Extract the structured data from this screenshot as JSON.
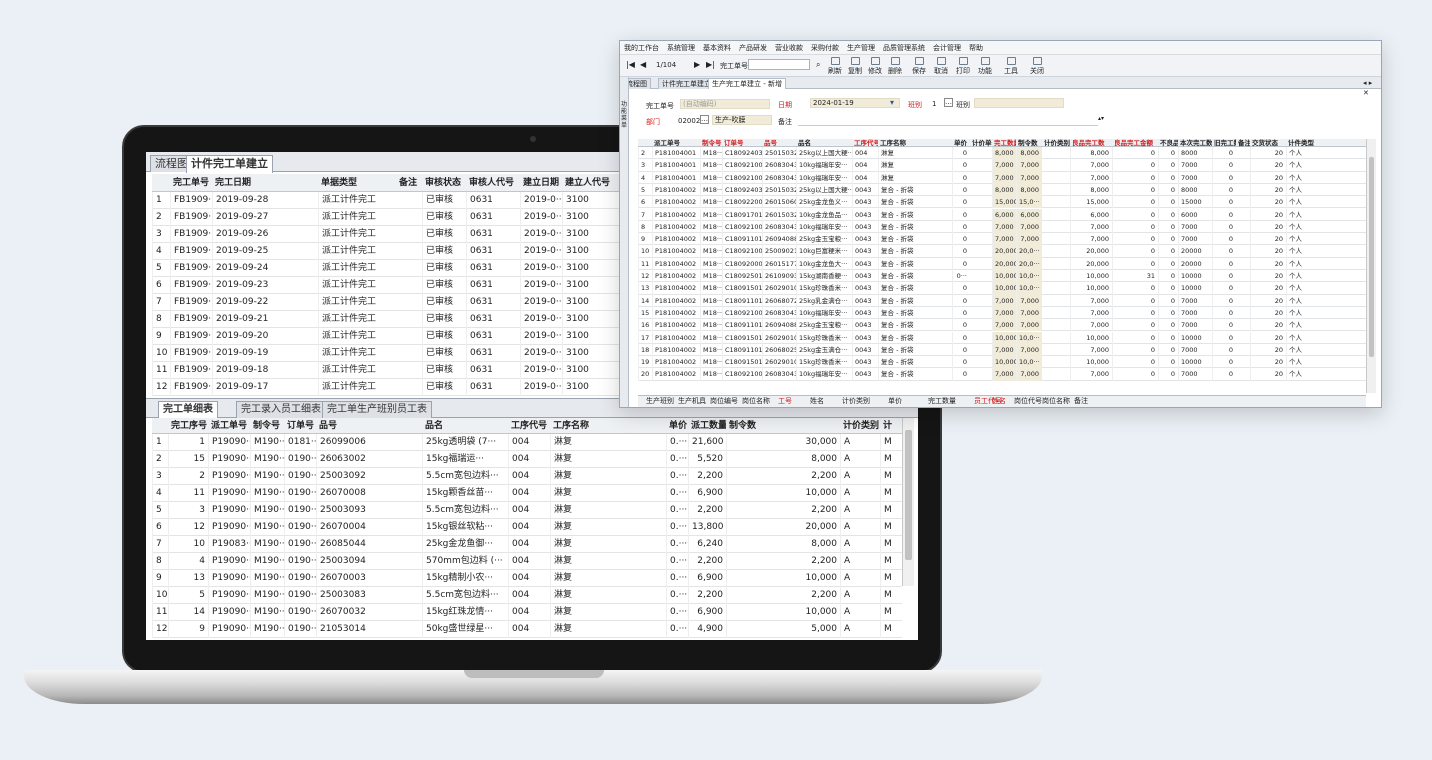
{
  "laptop": {
    "tabs": [
      "流程图",
      "计件完工单建立"
    ],
    "top_grid": {
      "headers": [
        "完工单号",
        "完工日期",
        "单据类型",
        "备注",
        "审核状态",
        "审核人代号",
        "建立日期",
        "建立人代号"
      ],
      "rows": [
        [
          "1",
          "FB1909···",
          "2019-09-28",
          "派工计件完工",
          "",
          "已审核",
          "0631",
          "2019-0···",
          "3100"
        ],
        [
          "2",
          "FB1909···",
          "2019-09-27",
          "派工计件完工",
          "",
          "已审核",
          "0631",
          "2019-0···",
          "3100"
        ],
        [
          "3",
          "FB1909···",
          "2019-09-26",
          "派工计件完工",
          "",
          "已审核",
          "0631",
          "2019-0···",
          "3100"
        ],
        [
          "4",
          "FB1909···",
          "2019-09-25",
          "派工计件完工",
          "",
          "已审核",
          "0631",
          "2019-0···",
          "3100"
        ],
        [
          "5",
          "FB1909···",
          "2019-09-24",
          "派工计件完工",
          "",
          "已审核",
          "0631",
          "2019-0···",
          "3100"
        ],
        [
          "6",
          "FB1909···",
          "2019-09-23",
          "派工计件完工",
          "",
          "已审核",
          "0631",
          "2019-0···",
          "3100"
        ],
        [
          "7",
          "FB1909···",
          "2019-09-22",
          "派工计件完工",
          "",
          "已审核",
          "0631",
          "2019-0···",
          "3100"
        ],
        [
          "8",
          "FB1909···",
          "2019-09-21",
          "派工计件完工",
          "",
          "已审核",
          "0631",
          "2019-0···",
          "3100"
        ],
        [
          "9",
          "FB1909···",
          "2019-09-20",
          "派工计件完工",
          "",
          "已审核",
          "0631",
          "2019-0···",
          "3100"
        ],
        [
          "10",
          "FB1909···",
          "2019-09-19",
          "派工计件完工",
          "",
          "已审核",
          "0631",
          "2019-0···",
          "3100"
        ],
        [
          "11",
          "FB1909···",
          "2019-09-18",
          "派工计件完工",
          "",
          "已审核",
          "0631",
          "2019-0···",
          "3100"
        ],
        [
          "12",
          "FB1909···",
          "2019-09-17",
          "派工计件完工",
          "",
          "已审核",
          "0631",
          "2019-0···",
          "3100"
        ]
      ]
    },
    "detail_tabs": [
      "完工单细表",
      "完工录入员工细表",
      "完工单生产班别员工表"
    ],
    "bottom_grid": {
      "headers": [
        "完工序号",
        "派工单号",
        "制令号",
        "订单号",
        "品号",
        "品名",
        "工序代号",
        "工序名称",
        "单价",
        "派工数量",
        "制令数",
        "计价类别",
        "计"
      ],
      "rows": [
        [
          "1",
          "1",
          "P19090···",
          "M190···",
          "0181···",
          "26099006",
          "25kg透明袋 (7···",
          "004",
          "淋复",
          "0.···",
          "21,600",
          "30,000",
          "A",
          "M"
        ],
        [
          "2",
          "15",
          "P19090···",
          "M190···",
          "0190···",
          "26063002",
          "15kg福瑞运···",
          "004",
          "淋复",
          "0.···",
          "5,520",
          "8,000",
          "A",
          "M"
        ],
        [
          "3",
          "2",
          "P19090···",
          "M190···",
          "0190···",
          "25003092",
          "5.5cm宽包边料···",
          "004",
          "淋复",
          "0.···",
          "2,200",
          "2,200",
          "A",
          "M"
        ],
        [
          "4",
          "11",
          "P19090···",
          "M190···",
          "0190···",
          "26070008",
          "15kg颗香丝苗···",
          "004",
          "淋复",
          "0.···",
          "6,900",
          "10,000",
          "A",
          "M"
        ],
        [
          "5",
          "3",
          "P19090···",
          "M190···",
          "0190···",
          "25003093",
          "5.5cm宽包边料···",
          "004",
          "淋复",
          "0.···",
          "2,200",
          "2,200",
          "A",
          "M"
        ],
        [
          "6",
          "12",
          "P19090···",
          "M190···",
          "0190···",
          "26070004",
          "15kg银丝软粘···",
          "004",
          "淋复",
          "0.···",
          "13,800",
          "20,000",
          "A",
          "M"
        ],
        [
          "7",
          "10",
          "P19083···",
          "M190···",
          "0190···",
          "26085044",
          "25kg金龙鱼御···",
          "004",
          "淋复",
          "0.···",
          "6,240",
          "8,000",
          "A",
          "M"
        ],
        [
          "8",
          "4",
          "P19090···",
          "M190···",
          "0190···",
          "25003094",
          "570mm包边料 (···",
          "004",
          "淋复",
          "0.···",
          "2,200",
          "2,200",
          "A",
          "M"
        ],
        [
          "9",
          "13",
          "P19090···",
          "M190···",
          "0190···",
          "26070003",
          "15kg精制小农···",
          "004",
          "淋复",
          "0.···",
          "6,900",
          "10,000",
          "A",
          "M"
        ],
        [
          "10",
          "5",
          "P19090···",
          "M190···",
          "0190···",
          "25003083",
          "5.5cm宽包边料···",
          "004",
          "淋复",
          "0.···",
          "2,200",
          "2,200",
          "A",
          "M"
        ],
        [
          "11",
          "14",
          "P19090···",
          "M190···",
          "0190···",
          "26070032",
          "15kg红珠龙情···",
          "004",
          "淋复",
          "0.···",
          "6,900",
          "10,000",
          "A",
          "M"
        ],
        [
          "12",
          "9",
          "P19090···",
          "M190···",
          "0190···",
          "21053014",
          "50kg盛世绿星···",
          "004",
          "淋复",
          "0.···",
          "4,900",
          "5,000",
          "A",
          "M"
        ]
      ]
    }
  },
  "window": {
    "menu": [
      "我的工作台",
      "系统管理",
      "基本资料",
      "产品研发",
      "营业收款",
      "采购付款",
      "生产管理",
      "品质管理系统",
      "会计管理",
      "帮助"
    ],
    "toolbar": {
      "record_pos": "1/104",
      "search_label": "完工单号",
      "buttons": [
        "刷新",
        "复制",
        "修改",
        "删除",
        "保存",
        "取消",
        "打印",
        "功能",
        "工具",
        "关闭"
      ]
    },
    "tabs": [
      "流程图",
      "计件完工单建立",
      "生产完工单建立 - 新增"
    ],
    "side_label": "功能菜单",
    "form": {
      "no_label": "完工单号",
      "no_value": "(自动编码)",
      "date_label": "日期",
      "date_value": "2024-01-19",
      "shift_label": "班别",
      "shift_value": "1",
      "kind_label": "班别",
      "dept_label": "部门",
      "dept_code": "02002",
      "dept_name": "生产-吹膜",
      "note_label": "备注"
    },
    "grid": {
      "headers": [
        "",
        "派工单号",
        "制令号",
        "订单号",
        "品号",
        "品名",
        "工序代号",
        "工序名称",
        "单价",
        "计价单位",
        "完工数量",
        "制令数",
        "计价类别",
        "良品完工数",
        "良品完工金额",
        "不良品",
        "本次完工数",
        "旧完工数",
        "备注",
        "交货状态",
        "计件类型"
      ],
      "rows": [
        [
          "2",
          "P181004001",
          "M18···",
          "C180924030",
          "25015032",
          "25kg以上国大粳···",
          "004",
          "淋复",
          "0",
          "",
          "8,000",
          "8,000",
          "",
          "8,000",
          "0",
          "0",
          "8000",
          "0",
          "",
          "20",
          "个人"
        ],
        [
          "3",
          "P181004001",
          "M18···",
          "C180921006",
          "26083043",
          "10kg福瑞年安···",
          "004",
          "淋复",
          "0",
          "",
          "7,000",
          "7,000",
          "",
          "7,000",
          "0",
          "0",
          "7000",
          "0",
          "",
          "20",
          "个人"
        ],
        [
          "4",
          "P181004001",
          "M18···",
          "C180921006",
          "26083043",
          "10kg福瑞年安···",
          "004",
          "淋复",
          "0",
          "",
          "7,000",
          "7,000",
          "",
          "7,000",
          "0",
          "0",
          "7000",
          "0",
          "",
          "20",
          "个人"
        ],
        [
          "5",
          "P181004002",
          "M18···",
          "C180924030",
          "25015032",
          "25kg以上国大粳···",
          "0043",
          "复合 - 折袋",
          "0",
          "",
          "8,000",
          "8,000",
          "",
          "8,000",
          "0",
          "0",
          "8000",
          "0",
          "",
          "20",
          "个人"
        ],
        [
          "6",
          "P181004002",
          "M18···",
          "C180922005",
          "26015060",
          "25kg金龙鱼义···",
          "0043",
          "复合 - 折袋",
          "0",
          "",
          "15,000",
          "15,0···",
          "",
          "15,000",
          "0",
          "0",
          "15000",
          "0",
          "",
          "20",
          "个人"
        ],
        [
          "7",
          "P181004002",
          "M18···",
          "C180917018",
          "26015032",
          "10kg金龙鱼品···",
          "0043",
          "复合 - 折袋",
          "0",
          "",
          "6,000",
          "6,000",
          "",
          "6,000",
          "0",
          "0",
          "6000",
          "0",
          "",
          "20",
          "个人"
        ],
        [
          "8",
          "P181004002",
          "M18···",
          "C180921005",
          "26083043",
          "10kg福瑞年安···",
          "0043",
          "复合 - 折袋",
          "0",
          "",
          "7,000",
          "7,000",
          "",
          "7,000",
          "0",
          "0",
          "7000",
          "0",
          "",
          "20",
          "个人"
        ],
        [
          "9",
          "P181004002",
          "M18···",
          "C180911013",
          "26094088",
          "25kg金玉宝粮···",
          "0043",
          "复合 - 折袋",
          "0",
          "",
          "7,000",
          "7,000",
          "",
          "7,000",
          "0",
          "0",
          "7000",
          "0",
          "",
          "20",
          "个人"
        ],
        [
          "10",
          "P181004002",
          "M18···",
          "C180921004",
          "25009021",
          "10kg巨富粳米···",
          "0043",
          "复合 - 折袋",
          "0",
          "",
          "20,000",
          "20,0···",
          "",
          "20,000",
          "0",
          "0",
          "20000",
          "0",
          "",
          "20",
          "个人"
        ],
        [
          "11",
          "P181004002",
          "M18···",
          "C180920005",
          "26015177",
          "10kg金龙鱼大···",
          "0043",
          "复合 - 折袋",
          "0",
          "",
          "20,000",
          "20,0···",
          "",
          "20,000",
          "0",
          "0",
          "20000",
          "0",
          "",
          "20",
          "个人"
        ],
        [
          "12",
          "P181004002",
          "M18···",
          "C180925010",
          "26109093",
          "15kg湖南香粳···",
          "0043",
          "复合 - 折袋",
          "0···",
          "",
          "10,000",
          "10,0···",
          "",
          "10,000",
          "31",
          "0",
          "10000",
          "0",
          "",
          "20",
          "个人"
        ],
        [
          "13",
          "P181004002",
          "M18···",
          "C180915012",
          "26029010",
          "15kg珍珠香米···",
          "0043",
          "复合 - 折袋",
          "0",
          "",
          "10,000",
          "10,0···",
          "",
          "10,000",
          "0",
          "0",
          "10000",
          "0",
          "",
          "20",
          "个人"
        ],
        [
          "14",
          "P181004002",
          "M18···",
          "C180911010",
          "26068072",
          "25kg乳金满仓···",
          "0043",
          "复合 - 折袋",
          "0",
          "",
          "7,000",
          "7,000",
          "",
          "7,000",
          "0",
          "0",
          "7000",
          "0",
          "",
          "20",
          "个人"
        ],
        [
          "15",
          "P181004002",
          "M18···",
          "C180921005",
          "26083043",
          "10kg福瑞年安···",
          "0043",
          "复合 - 折袋",
          "0",
          "",
          "7,000",
          "7,000",
          "",
          "7,000",
          "0",
          "0",
          "7000",
          "0",
          "",
          "20",
          "个人"
        ],
        [
          "16",
          "P181004002",
          "M18···",
          "C180911013",
          "26094088",
          "25kg金玉宝粮···",
          "0043",
          "复合 - 折袋",
          "0",
          "",
          "7,000",
          "7,000",
          "",
          "7,000",
          "0",
          "0",
          "7000",
          "0",
          "",
          "20",
          "个人"
        ],
        [
          "17",
          "P181004002",
          "M18···",
          "C180915012",
          "26029010",
          "15kg珍珠香米···",
          "0043",
          "复合 - 折袋",
          "0",
          "",
          "10,000",
          "10,0···",
          "",
          "10,000",
          "0",
          "0",
          "10000",
          "0",
          "",
          "20",
          "个人"
        ],
        [
          "18",
          "P181004002",
          "M18···",
          "C180911010",
          "26068025",
          "25kg金玉满仓···",
          "0043",
          "复合 - 折袋",
          "0",
          "",
          "7,000",
          "7,000",
          "",
          "7,000",
          "0",
          "0",
          "7000",
          "0",
          "",
          "20",
          "个人"
        ],
        [
          "19",
          "P181004002",
          "M18···",
          "C180915012",
          "26029010",
          "15kg珍珠香米···",
          "0043",
          "复合 - 折袋",
          "0",
          "",
          "10,000",
          "10,0···",
          "",
          "10,000",
          "0",
          "0",
          "10000",
          "0",
          "",
          "20",
          "个人"
        ],
        [
          "20",
          "P181004002",
          "M18···",
          "C180921006",
          "26083043",
          "10kg福瑞年安···",
          "0043",
          "复合 - 折袋",
          "0",
          "",
          "7,000",
          "7,000",
          "",
          "7,000",
          "0",
          "0",
          "7000",
          "0",
          "",
          "20",
          "个人"
        ]
      ]
    },
    "footer": [
      "生产班别",
      "生产机具",
      "岗位编号",
      "岗位名称",
      "工号",
      "姓名",
      "计价类别",
      "单价",
      "完工数量",
      "员工代号",
      "姓名",
      "岗位代号",
      "岗位名称",
      "备注"
    ]
  },
  "colors": {
    "accent_red": "#d21b1b",
    "field_beige": "#f1ecd9",
    "background": "#eaf0f5"
  }
}
